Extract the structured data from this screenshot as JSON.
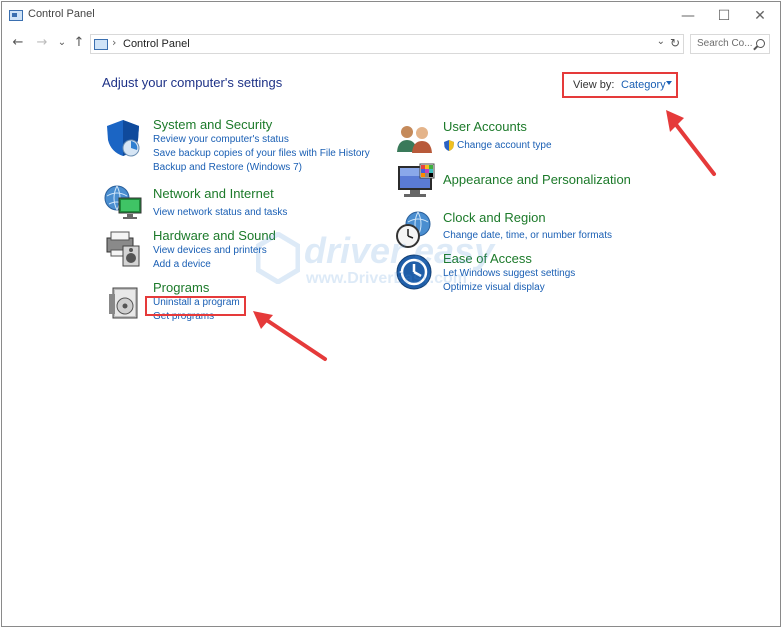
{
  "window": {
    "title": "Control Panel",
    "minimize": "—",
    "maximize": "☐",
    "close": "✕"
  },
  "nav": {
    "back": "←",
    "forward": "→",
    "recent": "⌄",
    "up": "↑"
  },
  "address": {
    "separator": "›",
    "path": "Control Panel",
    "dropdown": "⌄",
    "refresh": "↻"
  },
  "search": {
    "placeholder": "Search Co..."
  },
  "heading": "Adjust your computer's settings",
  "view_by": {
    "label": "View by:",
    "value": "Category"
  },
  "categories": {
    "system": {
      "title": "System and Security",
      "links": [
        "Review your computer's status",
        "Save backup copies of your files with File History",
        "Backup and Restore (Windows 7)"
      ]
    },
    "network": {
      "title": "Network and Internet",
      "links": [
        "View network status and tasks"
      ]
    },
    "hardware": {
      "title": "Hardware and Sound",
      "links": [
        "View devices and printers",
        "Add a device"
      ]
    },
    "programs": {
      "title": "Programs",
      "links": [
        "Uninstall a program",
        "Get programs"
      ]
    },
    "users": {
      "title": "User Accounts",
      "links": [
        "Change account type"
      ]
    },
    "appearance": {
      "title": "Appearance and Personalization",
      "links": []
    },
    "clock": {
      "title": "Clock and Region",
      "links": [
        "Change date, time, or number formats"
      ]
    },
    "ease": {
      "title": "Ease of Access",
      "links": [
        "Let Windows suggest settings",
        "Optimize visual display"
      ]
    }
  },
  "watermark": {
    "brand": "driver easy",
    "url": "www.DriverEasy.com"
  },
  "colors": {
    "category_title": "#1c7a2a",
    "link": "#1a5fb4",
    "heading": "#1e3287",
    "annotation": "#e53a3a"
  }
}
